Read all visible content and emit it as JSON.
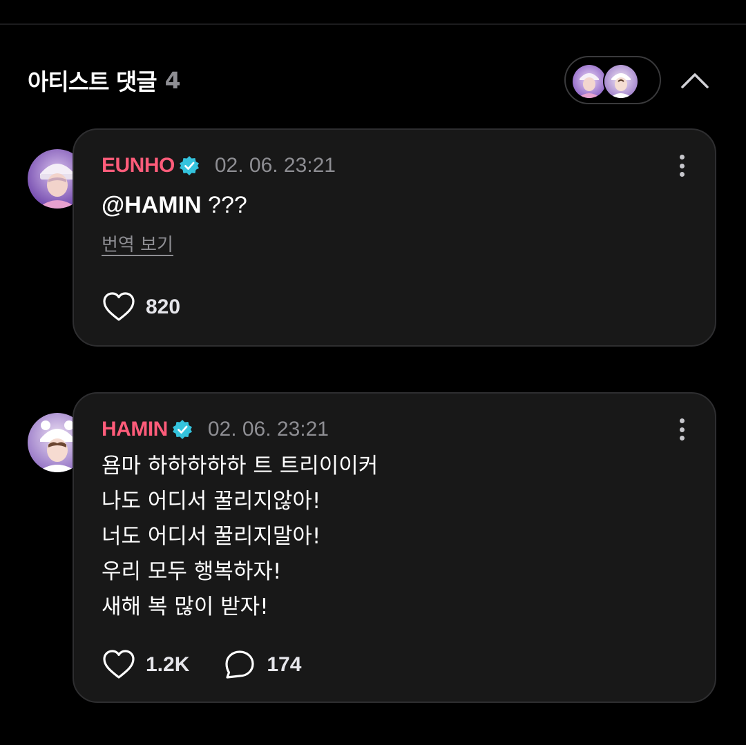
{
  "header": {
    "title": "아티스트 댓글",
    "count": "4"
  },
  "colors": {
    "background": "#000000",
    "card_background": "#181818",
    "username": "#ff5c7a",
    "verified_badge": "#34c3dd",
    "secondary_text": "#8e8e93"
  },
  "comments": [
    {
      "username": "EUNHO",
      "verified": true,
      "timestamp": "02. 06. 23:21",
      "mention": "@HAMIN",
      "text": " ???",
      "translate_label": "번역 보기",
      "likes": "820",
      "avatar_icon": "avatar-eunho"
    },
    {
      "username": "HAMIN",
      "verified": true,
      "timestamp": "02. 06. 23:21",
      "text": "욤마 하하하하하 트 트리이이커\n나도 어디서 꿀리지않아!\n너도 어디서 꿀리지말아!\n우리 모두 행복하자!\n새해 복 많이 받자!",
      "likes": "1.2K",
      "replies": "174",
      "avatar_icon": "avatar-hamin"
    }
  ]
}
